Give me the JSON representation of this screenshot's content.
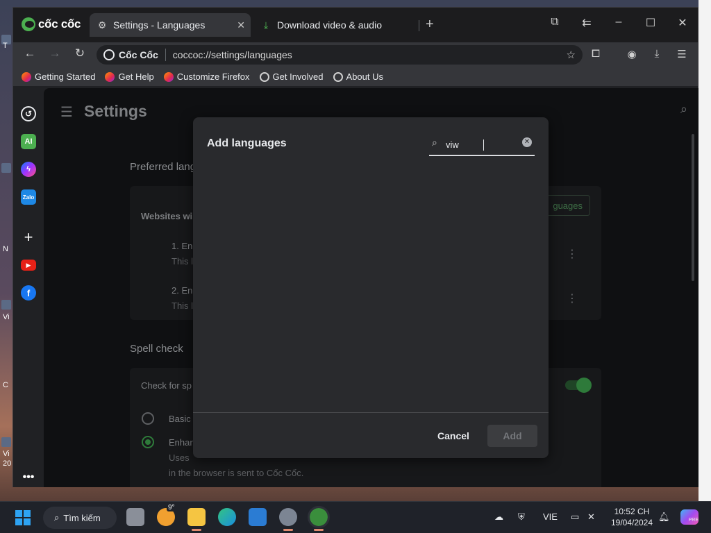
{
  "desktop": {
    "left_labels": [
      "T",
      "N",
      "Vi",
      "C",
      "Vi",
      "20"
    ]
  },
  "browser": {
    "logo_text": "cốc cốc",
    "tabs": [
      {
        "label": "Settings - Languages",
        "icon": "gear-icon",
        "active": true
      },
      {
        "label": "Download video & audio",
        "icon": "download-icon",
        "active": false
      }
    ],
    "address": {
      "badge": "Cốc Cốc",
      "url": "coccoc://settings/languages"
    },
    "bookmarks": [
      {
        "label": "Getting Started",
        "icon": "firefox-icon"
      },
      {
        "label": "Get Help",
        "icon": "firefox-icon"
      },
      {
        "label": "Customize Firefox",
        "icon": "firefox-icon"
      },
      {
        "label": "Get Involved",
        "icon": "globe-icon"
      },
      {
        "label": "About Us",
        "icon": "globe-icon"
      }
    ],
    "side_panel": [
      "history-icon",
      "ai-icon",
      "messenger-icon",
      "zalo-icon",
      "add-icon",
      "youtube-icon",
      "facebook-icon",
      "more-icon"
    ],
    "side_ai_text": "AI",
    "side_zalo_text": "Zalo"
  },
  "settings": {
    "title": "Settings",
    "preferred_languages_title": "Preferred lang",
    "websites_label": "Websites wi",
    "add_languages_button": "guages",
    "languages": [
      {
        "name": "1. Eng",
        "desc": "This l"
      },
      {
        "name": "2. Eng",
        "desc": "This l"
      }
    ],
    "spell_check_title": "Spell check",
    "check_for_label": "Check for sp",
    "basic_label": "Basic",
    "enhanced_label": "Enhan",
    "enhanced_desc_1": "Uses",
    "enhanced_desc_2": "in the browser is sent to Cốc Cốc."
  },
  "dialog": {
    "title": "Add languages",
    "search_value": "viw",
    "cancel_label": "Cancel",
    "add_label": "Add"
  },
  "taskbar": {
    "search_label": "Tìm kiếm",
    "weather_badge": "9°",
    "language": "VIE",
    "time": "10:52 CH",
    "date": "19/04/2024",
    "copilot_badge": "PRE"
  },
  "colors": {
    "accent_green": "#2e7a3a",
    "dialog_bg": "#292a2d",
    "chrome_bg": "#35363a"
  }
}
